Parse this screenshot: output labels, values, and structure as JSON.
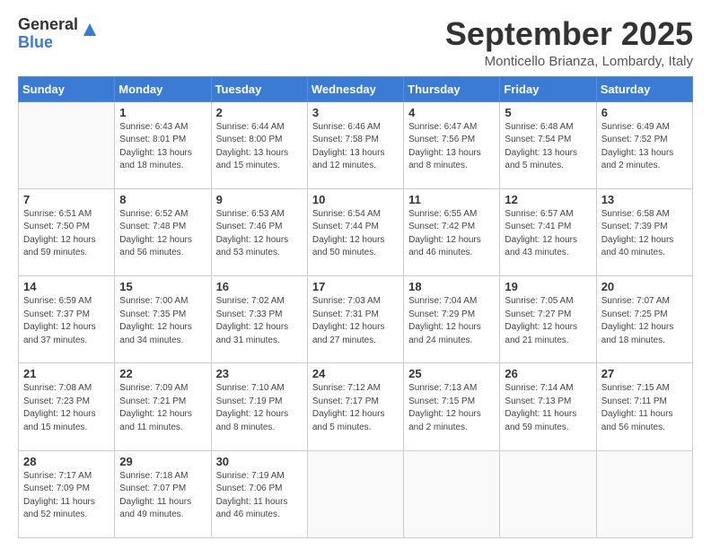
{
  "header": {
    "logo_general": "General",
    "logo_blue": "Blue",
    "month": "September 2025",
    "location": "Monticello Brianza, Lombardy, Italy"
  },
  "days_of_week": [
    "Sunday",
    "Monday",
    "Tuesday",
    "Wednesday",
    "Thursday",
    "Friday",
    "Saturday"
  ],
  "weeks": [
    [
      {
        "day": "",
        "info": ""
      },
      {
        "day": "1",
        "info": "Sunrise: 6:43 AM\nSunset: 8:01 PM\nDaylight: 13 hours\nand 18 minutes."
      },
      {
        "day": "2",
        "info": "Sunrise: 6:44 AM\nSunset: 8:00 PM\nDaylight: 13 hours\nand 15 minutes."
      },
      {
        "day": "3",
        "info": "Sunrise: 6:46 AM\nSunset: 7:58 PM\nDaylight: 13 hours\nand 12 minutes."
      },
      {
        "day": "4",
        "info": "Sunrise: 6:47 AM\nSunset: 7:56 PM\nDaylight: 13 hours\nand 8 minutes."
      },
      {
        "day": "5",
        "info": "Sunrise: 6:48 AM\nSunset: 7:54 PM\nDaylight: 13 hours\nand 5 minutes."
      },
      {
        "day": "6",
        "info": "Sunrise: 6:49 AM\nSunset: 7:52 PM\nDaylight: 13 hours\nand 2 minutes."
      }
    ],
    [
      {
        "day": "7",
        "info": "Sunrise: 6:51 AM\nSunset: 7:50 PM\nDaylight: 12 hours\nand 59 minutes."
      },
      {
        "day": "8",
        "info": "Sunrise: 6:52 AM\nSunset: 7:48 PM\nDaylight: 12 hours\nand 56 minutes."
      },
      {
        "day": "9",
        "info": "Sunrise: 6:53 AM\nSunset: 7:46 PM\nDaylight: 12 hours\nand 53 minutes."
      },
      {
        "day": "10",
        "info": "Sunrise: 6:54 AM\nSunset: 7:44 PM\nDaylight: 12 hours\nand 50 minutes."
      },
      {
        "day": "11",
        "info": "Sunrise: 6:55 AM\nSunset: 7:42 PM\nDaylight: 12 hours\nand 46 minutes."
      },
      {
        "day": "12",
        "info": "Sunrise: 6:57 AM\nSunset: 7:41 PM\nDaylight: 12 hours\nand 43 minutes."
      },
      {
        "day": "13",
        "info": "Sunrise: 6:58 AM\nSunset: 7:39 PM\nDaylight: 12 hours\nand 40 minutes."
      }
    ],
    [
      {
        "day": "14",
        "info": "Sunrise: 6:59 AM\nSunset: 7:37 PM\nDaylight: 12 hours\nand 37 minutes."
      },
      {
        "day": "15",
        "info": "Sunrise: 7:00 AM\nSunset: 7:35 PM\nDaylight: 12 hours\nand 34 minutes."
      },
      {
        "day": "16",
        "info": "Sunrise: 7:02 AM\nSunset: 7:33 PM\nDaylight: 12 hours\nand 31 minutes."
      },
      {
        "day": "17",
        "info": "Sunrise: 7:03 AM\nSunset: 7:31 PM\nDaylight: 12 hours\nand 27 minutes."
      },
      {
        "day": "18",
        "info": "Sunrise: 7:04 AM\nSunset: 7:29 PM\nDaylight: 12 hours\nand 24 minutes."
      },
      {
        "day": "19",
        "info": "Sunrise: 7:05 AM\nSunset: 7:27 PM\nDaylight: 12 hours\nand 21 minutes."
      },
      {
        "day": "20",
        "info": "Sunrise: 7:07 AM\nSunset: 7:25 PM\nDaylight: 12 hours\nand 18 minutes."
      }
    ],
    [
      {
        "day": "21",
        "info": "Sunrise: 7:08 AM\nSunset: 7:23 PM\nDaylight: 12 hours\nand 15 minutes."
      },
      {
        "day": "22",
        "info": "Sunrise: 7:09 AM\nSunset: 7:21 PM\nDaylight: 12 hours\nand 11 minutes."
      },
      {
        "day": "23",
        "info": "Sunrise: 7:10 AM\nSunset: 7:19 PM\nDaylight: 12 hours\nand 8 minutes."
      },
      {
        "day": "24",
        "info": "Sunrise: 7:12 AM\nSunset: 7:17 PM\nDaylight: 12 hours\nand 5 minutes."
      },
      {
        "day": "25",
        "info": "Sunrise: 7:13 AM\nSunset: 7:15 PM\nDaylight: 12 hours\nand 2 minutes."
      },
      {
        "day": "26",
        "info": "Sunrise: 7:14 AM\nSunset: 7:13 PM\nDaylight: 11 hours\nand 59 minutes."
      },
      {
        "day": "27",
        "info": "Sunrise: 7:15 AM\nSunset: 7:11 PM\nDaylight: 11 hours\nand 56 minutes."
      }
    ],
    [
      {
        "day": "28",
        "info": "Sunrise: 7:17 AM\nSunset: 7:09 PM\nDaylight: 11 hours\nand 52 minutes."
      },
      {
        "day": "29",
        "info": "Sunrise: 7:18 AM\nSunset: 7:07 PM\nDaylight: 11 hours\nand 49 minutes."
      },
      {
        "day": "30",
        "info": "Sunrise: 7:19 AM\nSunset: 7:06 PM\nDaylight: 11 hours\nand 46 minutes."
      },
      {
        "day": "",
        "info": ""
      },
      {
        "day": "",
        "info": ""
      },
      {
        "day": "",
        "info": ""
      },
      {
        "day": "",
        "info": ""
      }
    ]
  ]
}
